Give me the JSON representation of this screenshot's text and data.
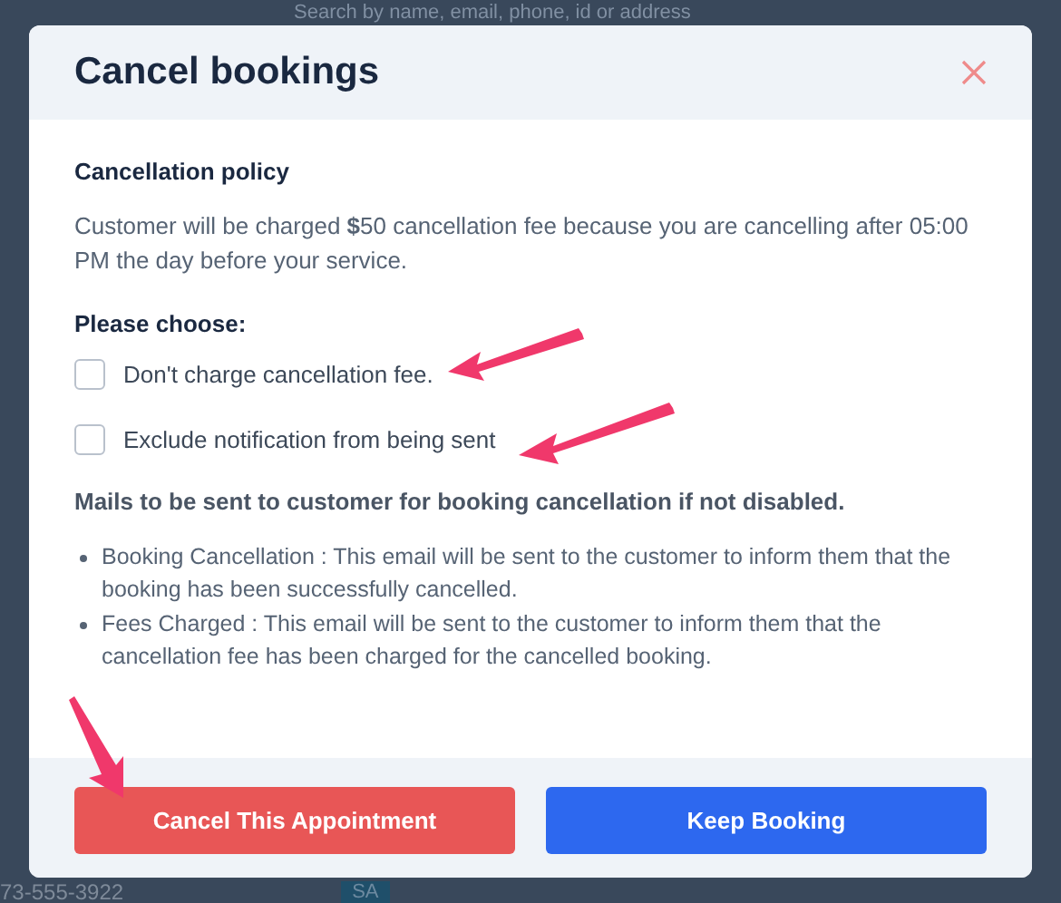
{
  "background": {
    "search": {
      "placeholder": "Search by name, email, phone, id or address"
    },
    "bottom_phone": "73-555-3922",
    "bottom_badge": "SA"
  },
  "dialog": {
    "title": "Cancel bookings",
    "policy": {
      "heading": "Cancellation policy",
      "text": "Customer will be charged **$**50 cancellation fee because you are cancelling after 05:00 PM the day before your service."
    },
    "choose_heading": "Please choose:",
    "options": [
      {
        "label": "Don't charge cancellation fee.",
        "checked": false
      },
      {
        "label": "Exclude notification from being sent",
        "checked": false
      }
    ],
    "mails_heading": "Mails to be sent to customer for booking cancellation if not disabled.",
    "mails": [
      "Booking Cancellation : This email will be sent to the customer to inform them that the booking has been successfully cancelled.",
      "Fees Charged : This email will be sent to the customer to inform them that the cancellation fee has been charged for the cancelled booking."
    ],
    "buttons": [
      {
        "label": "Cancel This Appointment",
        "kind": "danger"
      },
      {
        "label": "Keep Booking",
        "kind": "primary"
      }
    ]
  }
}
